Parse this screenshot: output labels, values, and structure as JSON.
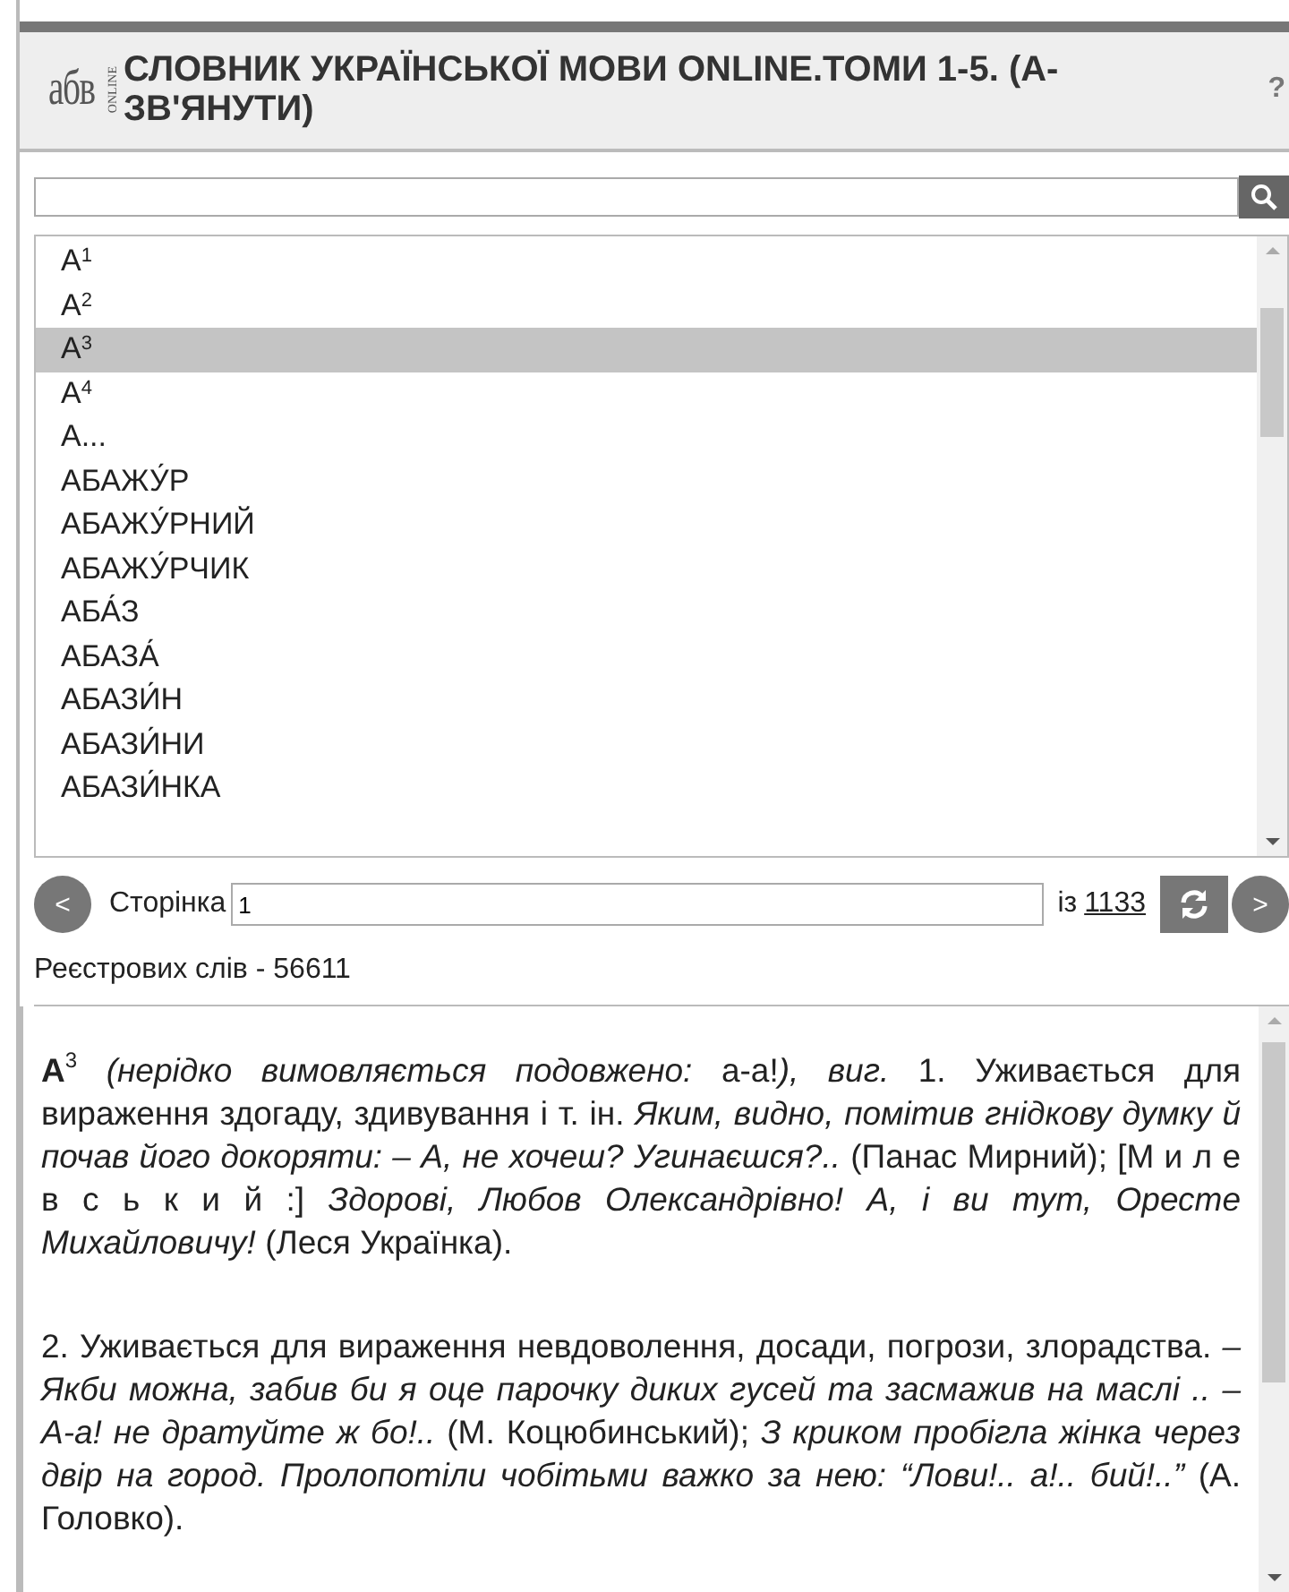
{
  "header": {
    "logo": {
      "letters": "абв",
      "tag": "ONLINE"
    },
    "title": "СЛОВНИК УКРАЇНСЬКОЇ МОВИ ONLINE.ТОМИ 1-5. (А-ЗВ'ЯНУТИ)",
    "help": "?"
  },
  "words": [
    {
      "text": "А$^{1}$",
      "selected": false
    },
    {
      "text": "А$^{2}$",
      "selected": false
    },
    {
      "text": "А$^{3}$",
      "selected": true
    },
    {
      "text": "А$^{4}$",
      "selected": false
    },
    {
      "text": "А...",
      "selected": false
    },
    {
      "text": "АБАЖУ́Р",
      "selected": false
    },
    {
      "text": "АБАЖУ́РНИЙ",
      "selected": false
    },
    {
      "text": "АБАЖУ́РЧИК",
      "selected": false
    },
    {
      "text": "АБА́З",
      "selected": false
    },
    {
      "text": "АБАЗА́",
      "selected": false
    },
    {
      "text": "АБАЗИ́Н",
      "selected": false
    },
    {
      "text": "АБАЗИ́НИ",
      "selected": false
    },
    {
      "text": "АБАЗИ́НКА",
      "selected": false
    }
  ],
  "pager": {
    "prev": "<",
    "label": "Сторінка",
    "page": "1",
    "of": "із",
    "total": "1133",
    "next": ">"
  },
  "count": "Реєстрових слів - 56611",
  "definition": [
    "**А**$^{3}$ *(нерідко вимовляється подовжено:* а-а!*), виг.* 1. Уживається для вираження здогаду, здивування і т. ін. *Яким, видно, помітив гнідкову думку й почав його докоряти: – А, не хочеш? Угинаєшся?..* (Панас Мирний); [М и л е в с ь к и й :] *Здорові, Любов Олександрівно! А, і ви тут, Оресте Михайловичу!* (Леся Українка).",
    "2. Уживається для вираження невдоволення, досади, погрози, злорадства. *– Якби можна, забив би я оце парочку диких гусей та засмажив на маслі .. – А-а! не дратуйте ж бо!..* (М. Коцюбинський); *З криком пробігла жінка через двір на город. Пролопотіли чобітьми важко за нею: “Лови!.. а!.. бий!..”* (А. Головко)."
  ]
}
